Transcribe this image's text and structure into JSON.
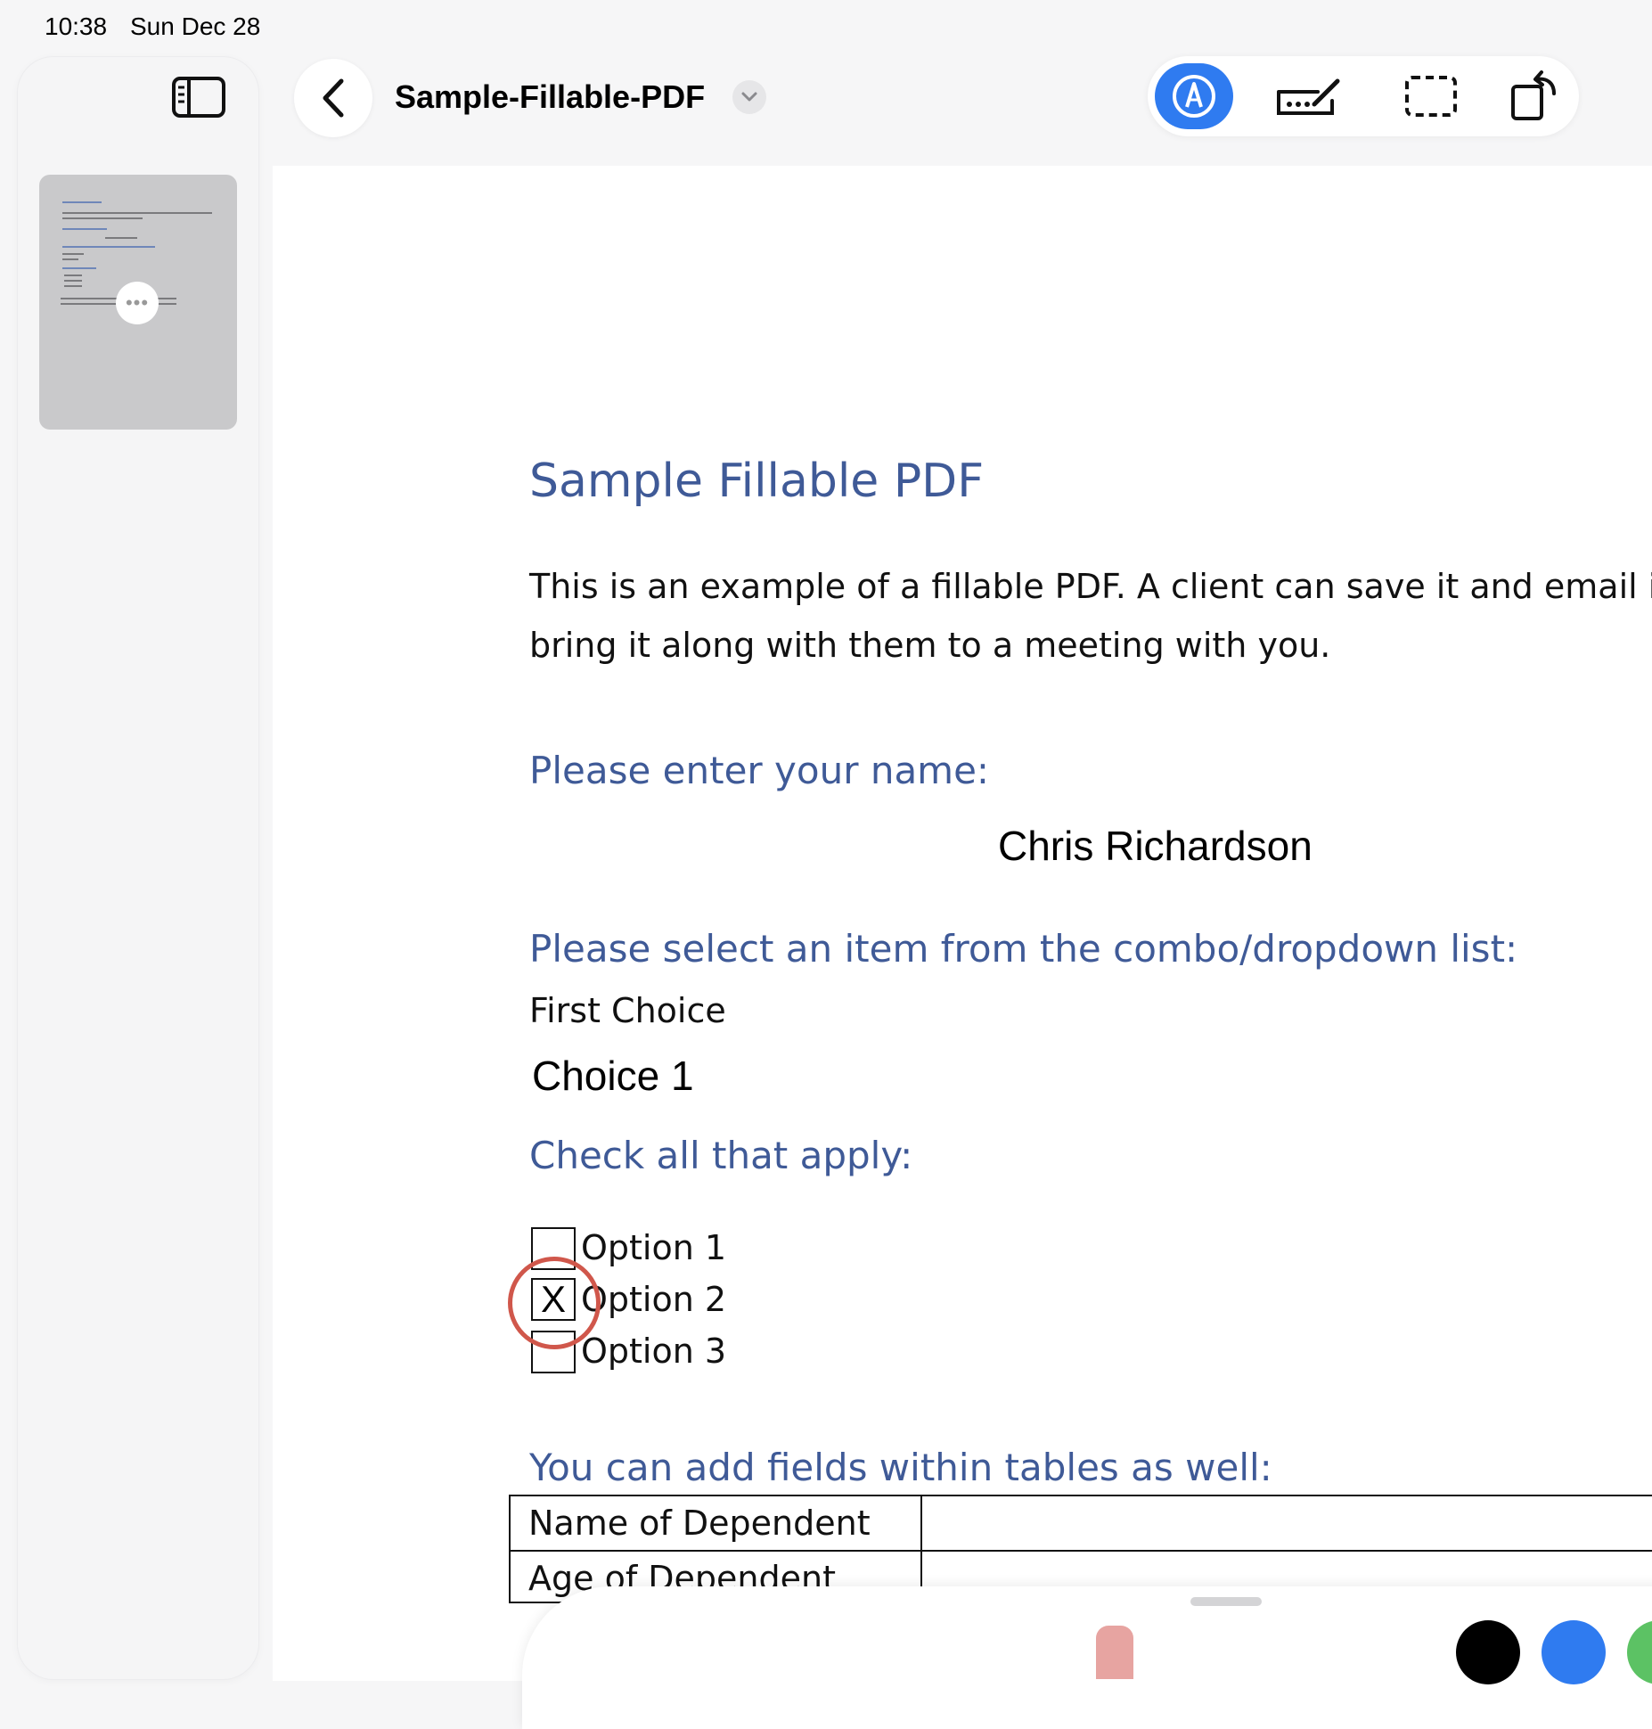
{
  "status": {
    "time": "10:38",
    "date": "Sun Dec 28"
  },
  "header": {
    "title": "Sample-Fillable-PDF"
  },
  "icons": {
    "sidebar_toggle": "sidebar-icon",
    "back": "chevron-left-icon",
    "title_menu": "chevron-down-icon",
    "markup": "pen-tip-icon",
    "signature": "signature-icon",
    "select": "dashed-rectangle-icon",
    "rotate": "rotate-icon",
    "thumbnail_more": "ellipsis-icon"
  },
  "colors": {
    "accent": "#2f7bf0",
    "heading": "#3f5a97",
    "focus_ring": "#d0574b"
  },
  "document": {
    "title": "Sample Fillable PDF",
    "intro_line1": "This is an example of a fillable PDF. A client can save it and email i",
    "intro_line2": "bring it along with them to a meeting with you.",
    "name_label": "Please enter your name:",
    "name_value": "Chris Richardson",
    "combo_label": "Please select an item from the combo/dropdown list:",
    "first_choice": "First Choice",
    "combo_value": "Choice 1",
    "check_label": "Check all that apply:",
    "options": [
      {
        "label": "Option 1",
        "mark": ""
      },
      {
        "label": "Option 2",
        "mark": "X"
      },
      {
        "label": "Option 3",
        "mark": ""
      }
    ],
    "table_label": "You can add  fields within tables as well:",
    "table_rows": [
      "Name of Dependent",
      "Age of Dependent"
    ]
  },
  "palette": {
    "swatches": [
      "#000000",
      "#2f7bf0",
      "#5cc264"
    ]
  }
}
